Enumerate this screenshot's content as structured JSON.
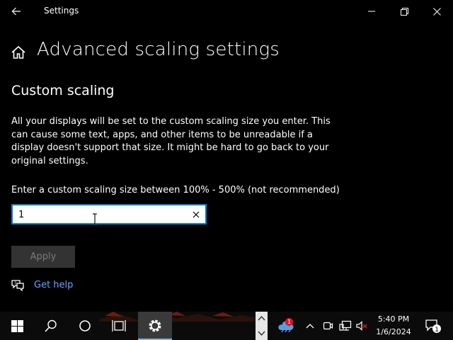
{
  "window": {
    "title": "Settings",
    "back_icon": "back-arrow-icon",
    "controls": [
      "minimize-icon",
      "maximize-icon",
      "close-icon"
    ]
  },
  "page": {
    "home_icon": "home-icon",
    "title": "Advanced scaling settings",
    "section_title": "Custom scaling",
    "description": "All your displays will be set to the custom scaling size you enter. This can cause some text, apps, and other items to be unreadable if a display doesn't support that size. It might be hard to go back to your original settings.",
    "input_label": "Enter a custom scaling size between 100% - 500% (not recommended)",
    "input_value": "1",
    "apply_label": "Apply",
    "help_label": "Get help"
  },
  "taskbar": {
    "time": "5:40 PM",
    "date": "1/6/2024",
    "tray_badge": "1",
    "notification_count": "1",
    "accent_color": "#0078d7",
    "link_color": "#68a6ff"
  }
}
